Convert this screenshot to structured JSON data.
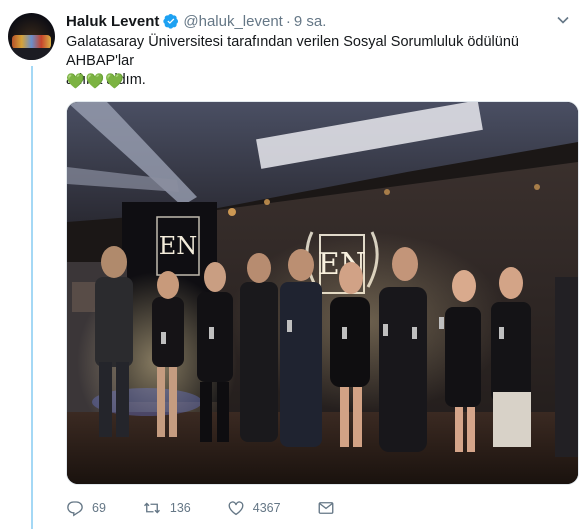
{
  "tweet": {
    "author_name": "Haluk Levent",
    "handle": "@haluk_levent",
    "separator": "·",
    "time": "9 sa.",
    "text_line1": "Galatasaray Üniversitesi tarafından verilen Sosyal Sorumluluk ödülünü AHBAP'lar",
    "text_line2": "adına aldım.",
    "emoji": "💚💚💚",
    "logo_text": "EN"
  },
  "actions": {
    "replies": "69",
    "retweets": "136",
    "likes": "4367"
  },
  "colors": {
    "verified": "#1da1f2",
    "thread_line": "#a4d8f5",
    "secondary_text": "#657786",
    "heart_green": "#77b255"
  },
  "icons": {
    "verified": "verified-badge-icon",
    "caret": "chevron-down-icon",
    "reply": "reply-icon",
    "retweet": "retweet-icon",
    "like": "heart-icon",
    "dm": "envelope-icon"
  }
}
